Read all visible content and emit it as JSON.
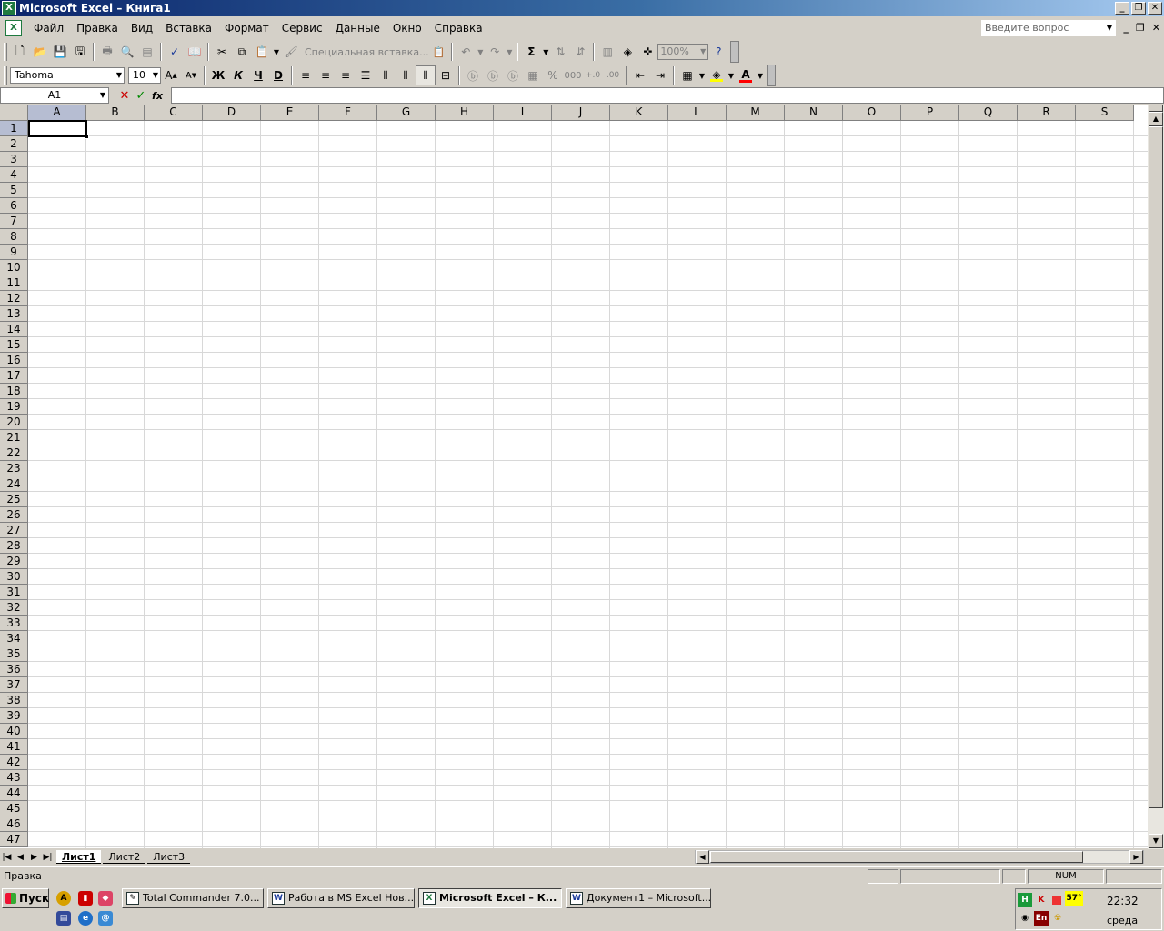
{
  "window": {
    "title": "Microsoft Excel – Книга1",
    "app_icon": "excel-icon"
  },
  "menu": {
    "items": [
      {
        "label": "Файл",
        "name": "file"
      },
      {
        "label": "Правка",
        "name": "edit"
      },
      {
        "label": "Вид",
        "name": "view"
      },
      {
        "label": "Вставка",
        "name": "insert"
      },
      {
        "label": "Формат",
        "name": "format"
      },
      {
        "label": "Сервис",
        "name": "tools"
      },
      {
        "label": "Данные",
        "name": "data"
      },
      {
        "label": "Окно",
        "name": "window"
      },
      {
        "label": "Справка",
        "name": "help"
      }
    ],
    "help_search_placeholder": "Введите вопрос"
  },
  "standard_toolbar": {
    "paste_special_label": "Специальная вставка...",
    "zoom": "100%",
    "sum_symbol": "Σ"
  },
  "format_toolbar": {
    "font_name": "Tahoma",
    "font_size": "10",
    "bold_label": "Ж",
    "italic_label": "К",
    "underline_label": "Ч",
    "strike_label": "D",
    "percent_label": "%",
    "thousands_label": "000",
    "font_color_label": "A",
    "font_color": "#ff0000",
    "fill_color": "#ffff00"
  },
  "formula_bar": {
    "name_box": "A1",
    "fx_label": "fx",
    "value": ""
  },
  "grid": {
    "columns": [
      "A",
      "B",
      "C",
      "D",
      "E",
      "F",
      "G",
      "H",
      "I",
      "J",
      "K",
      "L",
      "M",
      "N",
      "O",
      "P",
      "Q",
      "R",
      "S"
    ],
    "row_count": 47,
    "selected_column": "A",
    "selected_row": 1
  },
  "sheets": {
    "tabs": [
      "Лист1",
      "Лист2",
      "Лист3"
    ],
    "active": "Лист1"
  },
  "status": {
    "mode": "Правка",
    "num_lock": "NUM"
  },
  "taskbar": {
    "start_label": "Пуск",
    "tasks": [
      {
        "label": "Total Commander 7.0...",
        "icon": "total-commander-icon",
        "active": false
      },
      {
        "label": "Работа в  MS Excel Нов...",
        "icon": "word-icon",
        "active": false
      },
      {
        "label": "Microsoft Excel – К...",
        "icon": "excel-icon",
        "active": true
      },
      {
        "label": "Документ1 – Microsoft...",
        "icon": "word-icon",
        "active": false
      }
    ],
    "tray": {
      "temperature": "57°",
      "language": "En",
      "time": "22:32",
      "day": "среда"
    }
  }
}
